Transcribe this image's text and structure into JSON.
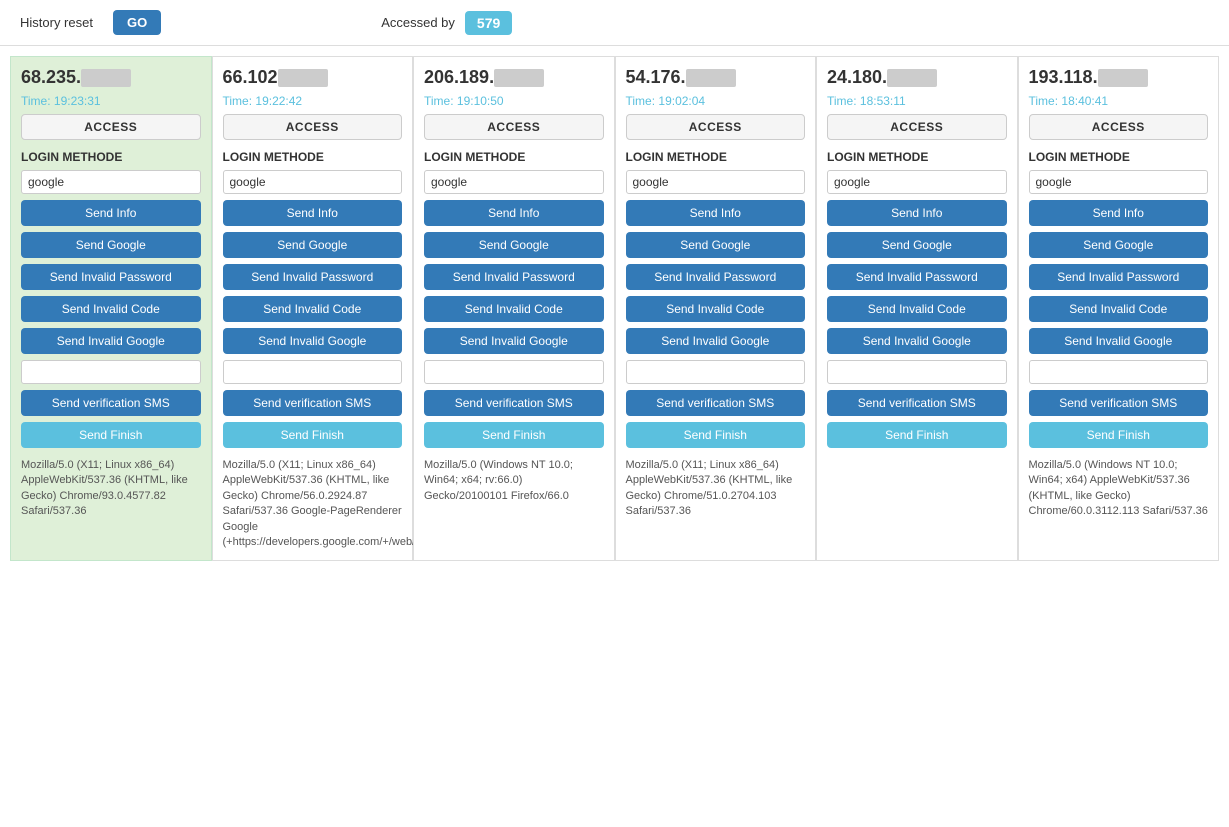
{
  "topbar": {
    "history_label": "History reset",
    "go_label": "GO",
    "accessed_label": "Accessed by",
    "accessed_count": "579"
  },
  "cards": [
    {
      "ip": "68.235.",
      "time": "Time: 19:23:31",
      "access_label": "ACCESS",
      "login_method_label": "LOGIN METHODE",
      "login_method_value": "google",
      "buttons": {
        "send_info": "Send Info",
        "send_google": "Send Google",
        "send_invalid_password": "Send Invalid Password",
        "send_invalid_code": "Send Invalid Code",
        "send_invalid_google": "Send Invalid Google",
        "send_sms": "Send verification SMS",
        "send_finish": "Send Finish"
      },
      "user_agent": "Mozilla/5.0 (X11; Linux x86_64) AppleWebKit/537.36 (KHTML, like Gecko) Chrome/93.0.4577.82 Safari/537.36",
      "active": true
    },
    {
      "ip": "66.102",
      "time": "Time: 19:22:42",
      "access_label": "ACCESS",
      "login_method_label": "LOGIN METHODE",
      "login_method_value": "google",
      "buttons": {
        "send_info": "Send Info",
        "send_google": "Send Google",
        "send_invalid_password": "Send Invalid Password",
        "send_invalid_code": "Send Invalid Code",
        "send_invalid_google": "Send Invalid Google",
        "send_sms": "Send verification SMS",
        "send_finish": "Send Finish"
      },
      "user_agent": "Mozilla/5.0 (X11; Linux x86_64) AppleWebKit/537.36 (KHTML, like Gecko) Chrome/56.0.2924.87 Safari/537.36 Google-PageRenderer Google (+https://developers.google.com/+/web/snippet/)",
      "active": false
    },
    {
      "ip": "206.189.",
      "time": "Time: 19:10:50",
      "access_label": "ACCESS",
      "login_method_label": "LOGIN METHODE",
      "login_method_value": "google",
      "buttons": {
        "send_info": "Send Info",
        "send_google": "Send Google",
        "send_invalid_password": "Send Invalid Password",
        "send_invalid_code": "Send Invalid Code",
        "send_invalid_google": "Send Invalid Google",
        "send_sms": "Send verification SMS",
        "send_finish": "Send Finish"
      },
      "user_agent": "Mozilla/5.0 (Windows NT 10.0; Win64; x64; rv:66.0) Gecko/20100101 Firefox/66.0",
      "active": false
    },
    {
      "ip": "54.176.",
      "time": "Time: 19:02:04",
      "access_label": "ACCESS",
      "login_method_label": "LOGIN METHODE",
      "login_method_value": "google",
      "buttons": {
        "send_info": "Send Info",
        "send_google": "Send Google",
        "send_invalid_password": "Send Invalid Password",
        "send_invalid_code": "Send Invalid Code",
        "send_invalid_google": "Send Invalid Google",
        "send_sms": "Send verification SMS",
        "send_finish": "Send Finish"
      },
      "user_agent": "Mozilla/5.0 (X11; Linux x86_64) AppleWebKit/537.36 (KHTML, like Gecko) Chrome/51.0.2704.103 Safari/537.36",
      "active": false
    },
    {
      "ip": "24.180.",
      "time": "Time: 18:53:11",
      "access_label": "ACCESS",
      "login_method_label": "LOGIN METHODE",
      "login_method_value": "google",
      "buttons": {
        "send_info": "Send Info",
        "send_google": "Send Google",
        "send_invalid_password": "Send Invalid Password",
        "send_invalid_code": "Send Invalid Code",
        "send_invalid_google": "Send Invalid Google",
        "send_sms": "Send verification SMS",
        "send_finish": "Send Finish"
      },
      "user_agent": "",
      "active": false
    },
    {
      "ip": "193.118.",
      "time": "Time: 18:40:41",
      "access_label": "ACCESS",
      "login_method_label": "LOGIN METHODE",
      "login_method_value": "google",
      "buttons": {
        "send_info": "Send Info",
        "send_google": "Send Google",
        "send_invalid_password": "Send Invalid Password",
        "send_invalid_code": "Send Invalid Code",
        "send_invalid_google": "Send Invalid Google",
        "send_sms": "Send verification SMS",
        "send_finish": "Send Finish"
      },
      "user_agent": "Mozilla/5.0 (Windows NT 10.0; Win64; x64) AppleWebKit/537.36 (KHTML, like Gecko) Chrome/60.0.3112.113 Safari/537.36",
      "active": false
    }
  ]
}
